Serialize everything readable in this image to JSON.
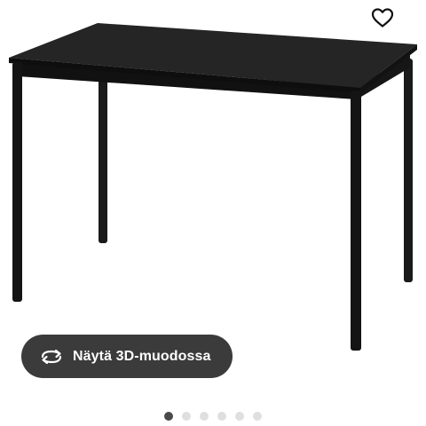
{
  "product": {
    "image_alt": "black rectangular table",
    "colors": {
      "table": "#151515",
      "table_top": "#222222"
    }
  },
  "favorite": {
    "icon": "heart-outline-icon"
  },
  "view_3d": {
    "label": "Näytä 3D-muodossa",
    "icon": "rotate-arrows-icon",
    "background": "#3b3b3b"
  },
  "carousel": {
    "total": 6,
    "active_index": 0,
    "dot_color": "#dfdfdf",
    "active_color": "#4a4a4a"
  }
}
